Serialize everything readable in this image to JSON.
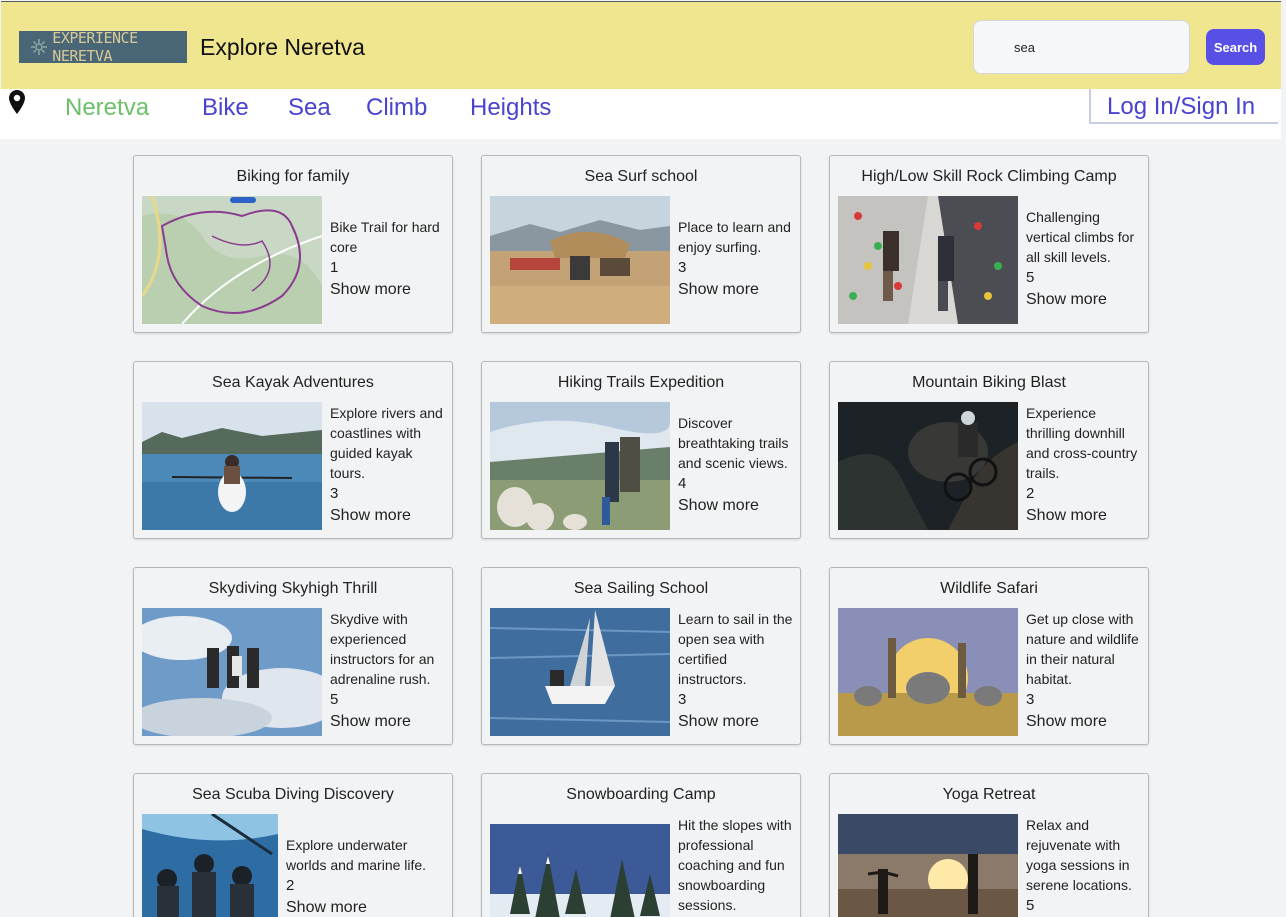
{
  "header": {
    "logo_text": "EXPERIENCE NERETVA",
    "site_title": "Explore Neretva",
    "search_value": "sea",
    "search_button": "Search"
  },
  "nav": {
    "items": [
      "Neretva",
      "Bike",
      "Sea",
      "Climb",
      "Heights"
    ],
    "login": "Log In/Sign In"
  },
  "cards": [
    {
      "title": "Biking for family",
      "description": "Bike Trail for hard core",
      "rating": "1",
      "more": "Show more",
      "image": "map-trail"
    },
    {
      "title": "Sea Surf school",
      "description": "Place to learn and enjoy surfing.",
      "rating": "3",
      "more": "Show more",
      "image": "beach-camp"
    },
    {
      "title": "High/Low Skill Rock Climbing Camp",
      "description": "Challenging vertical climbs for all skill levels.",
      "rating": "5",
      "more": "Show more",
      "image": "climbing-wall"
    },
    {
      "title": "Sea Kayak Adventures",
      "description": "Explore rivers and coastlines with guided kayak tours.",
      "rating": "3",
      "more": "Show more",
      "image": "kayak-lake"
    },
    {
      "title": "Hiking Trails Expedition",
      "description": "Discover breathtaking trails and scenic views.",
      "rating": "4",
      "more": "Show more",
      "image": "hikers-rocks"
    },
    {
      "title": "Mountain Biking Blast",
      "description": "Experience thrilling downhill and cross-country trails.",
      "rating": "2",
      "more": "Show more",
      "image": "mountain-biker"
    },
    {
      "title": "Skydiving Skyhigh Thrill",
      "description": "Skydive with experienced instructors for an adrenaline rush.",
      "rating": "5",
      "more": "Show more",
      "image": "skydivers"
    },
    {
      "title": "Sea Sailing School",
      "description": "Learn to sail in the open sea with certified instructors.",
      "rating": "3",
      "more": "Show more",
      "image": "sailboat"
    },
    {
      "title": "Wildlife Safari",
      "description": "Get up close with nature and wildlife in their natural habitat.",
      "rating": "3",
      "more": "Show more",
      "image": "safari-animals"
    },
    {
      "title": "Sea Scuba Diving Discovery",
      "description": "Explore underwater worlds and marine life.",
      "rating": "2",
      "more": "Show more",
      "image": "scuba-divers"
    },
    {
      "title": "Snowboarding Camp",
      "description": "Hit the slopes with professional coaching and fun snowboarding sessions.",
      "rating": "",
      "more": "",
      "image": "snowy-forest"
    },
    {
      "title": "Yoga Retreat",
      "description": "Relax and rejuvenate with yoga sessions in serene locations.",
      "rating": "5",
      "more": "",
      "image": "yoga-sunset"
    }
  ],
  "colors": {
    "header_bg": "#f1e690",
    "nav_link": "#4a43cf",
    "nav_active": "#6cc06a",
    "search_button": "#5850e6"
  }
}
